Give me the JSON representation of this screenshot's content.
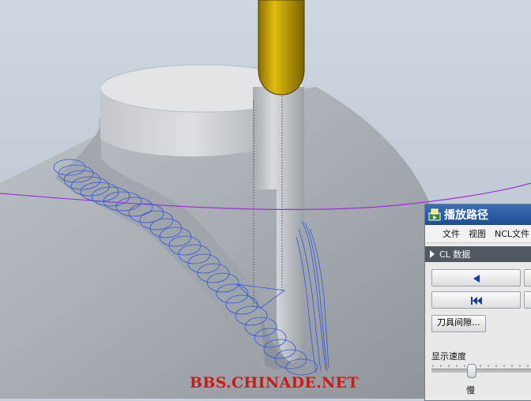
{
  "watermark": "BBS.CHINADE.NET",
  "dialog": {
    "title": "播放路径",
    "menu": [
      "文件",
      "视图",
      "NCL文件"
    ],
    "section_label": "CL 数据",
    "clearance_button": "刀具间隙...",
    "speed_label": "显示速度",
    "slow_label": "慢",
    "speed_level": 0.15
  },
  "icons": [
    "play-path-icon",
    "section-expand-icon",
    "play-reverse-icon",
    "rewind-to-start-icon"
  ],
  "colors": {
    "tool_holder": "#c9a400",
    "toolpath": "#2f56e0",
    "reference_curve": "#a12ce0",
    "title_bar": "#2b5ea3",
    "watermark": "#d01818"
  }
}
